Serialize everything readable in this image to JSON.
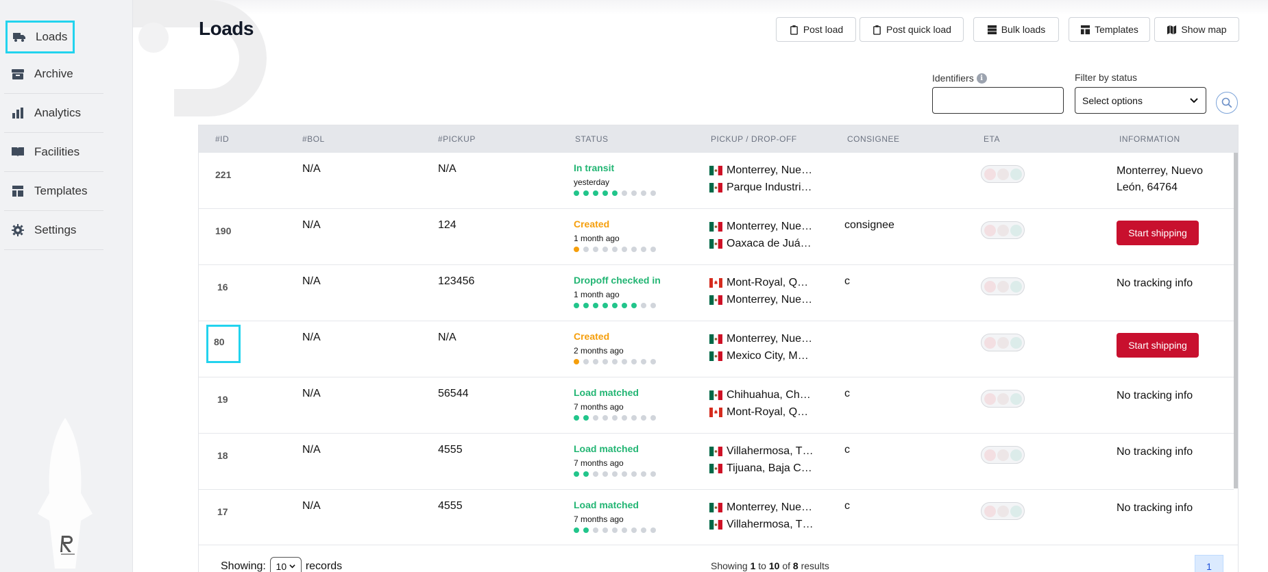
{
  "sidebar": {
    "items": [
      {
        "label": "Loads",
        "icon": "truck-icon",
        "active": true
      },
      {
        "label": "Archive",
        "icon": "archive-icon"
      },
      {
        "label": "Analytics",
        "icon": "bar-chart-icon"
      },
      {
        "label": "Facilities",
        "icon": "book-icon"
      },
      {
        "label": "Templates",
        "icon": "template-icon"
      },
      {
        "label": "Settings",
        "icon": "gear-icon"
      }
    ]
  },
  "header": {
    "title": "Loads",
    "buttons": {
      "post_load": "Post load",
      "post_quick_load": "Post quick load",
      "bulk_loads": "Bulk loads",
      "templates": "Templates",
      "show_map": "Show map"
    }
  },
  "filters": {
    "identifiers_label": "Identifiers",
    "identifiers_value": "",
    "status_label": "Filter by status",
    "status_placeholder": "Select options"
  },
  "table": {
    "columns": [
      "#ID",
      "#BOL",
      "#PICKUP",
      "STATUS",
      "PICKUP / DROP-OFF",
      "CONSIGNEE",
      "ETA",
      "INFORMATION"
    ],
    "rows": [
      {
        "id": "221",
        "bol": "N/A",
        "pickup": "N/A",
        "status": "In transit",
        "status_color": "#22b573",
        "time": "yesterday",
        "progress": 5,
        "progress_color": "green",
        "from": "Monterrey, Nue…",
        "from_flag": "mx",
        "to": "Parque Industri…",
        "to_flag": "mx",
        "consignee": "",
        "info_line1": "Monterrey, Nuevo",
        "info_line2": "León, 64764",
        "action": ""
      },
      {
        "id": "190",
        "bol": "N/A",
        "pickup": "124",
        "status": "Created",
        "status_color": "#f59e0b",
        "time": "1 month ago",
        "progress": 1,
        "progress_color": "orange",
        "from": "Monterrey, Nue…",
        "from_flag": "mx",
        "to": "Oaxaca de Juá…",
        "to_flag": "mx",
        "consignee": "consignee",
        "info_line1": "",
        "info_line2": "",
        "action": "Start shipping"
      },
      {
        "id": "16",
        "bol": "N/A",
        "pickup": "123456",
        "status": "Dropoff checked in",
        "status_color": "#22b573",
        "time": "1 month ago",
        "progress": 7,
        "progress_color": "green",
        "from": "Mont-Royal, Q…",
        "from_flag": "ca",
        "to": "Monterrey, Nue…",
        "to_flag": "mx",
        "consignee": "c",
        "info_line1": "No tracking info",
        "info_line2": "",
        "action": ""
      },
      {
        "id": "80",
        "bol": "N/A",
        "pickup": "N/A",
        "status": "Created",
        "status_color": "#f59e0b",
        "time": "2 months ago",
        "progress": 1,
        "progress_color": "orange",
        "from": "Monterrey, Nue…",
        "from_flag": "mx",
        "to": "Mexico City, M…",
        "to_flag": "mx",
        "consignee": "",
        "info_line1": "",
        "info_line2": "",
        "action": "Start shipping"
      },
      {
        "id": "19",
        "bol": "N/A",
        "pickup": "56544",
        "status": "Load matched",
        "status_color": "#22b573",
        "time": "7 months ago",
        "progress": 2,
        "progress_color": "green",
        "from": "Chihuahua, Ch…",
        "from_flag": "mx",
        "to": "Mont-Royal, Q…",
        "to_flag": "ca",
        "consignee": "c",
        "info_line1": "No tracking info",
        "info_line2": "",
        "action": ""
      },
      {
        "id": "18",
        "bol": "N/A",
        "pickup": "4555",
        "status": "Load matched",
        "status_color": "#22b573",
        "time": "7 months ago",
        "progress": 2,
        "progress_color": "green",
        "from": "Villahermosa, T…",
        "from_flag": "mx",
        "to": "Tijuana, Baja C…",
        "to_flag": "mx",
        "consignee": "c",
        "info_line1": "No tracking info",
        "info_line2": "",
        "action": ""
      },
      {
        "id": "17",
        "bol": "N/A",
        "pickup": "4555",
        "status": "Load matched",
        "status_color": "#22b573",
        "time": "7 months ago",
        "progress": 2,
        "progress_color": "green",
        "from": "Monterrey, Nue…",
        "from_flag": "mx",
        "to": "Villahermosa, T…",
        "to_flag": "mx",
        "consignee": "c",
        "info_line1": "No tracking info",
        "info_line2": "",
        "action": ""
      }
    ]
  },
  "footer": {
    "showing_label": "Showing:",
    "records_value": "10",
    "records_label": "records",
    "results_prefix": "Showing",
    "results_from": "1",
    "results_to_word": "to",
    "results_to": "10",
    "results_of_word": "of",
    "results_total": "8",
    "results_suffix": "results",
    "current_page": "1"
  },
  "colors": {
    "accent_highlight": "#22d3ee",
    "danger": "#c8102e",
    "success": "#22b573",
    "warning": "#f59e0b"
  }
}
